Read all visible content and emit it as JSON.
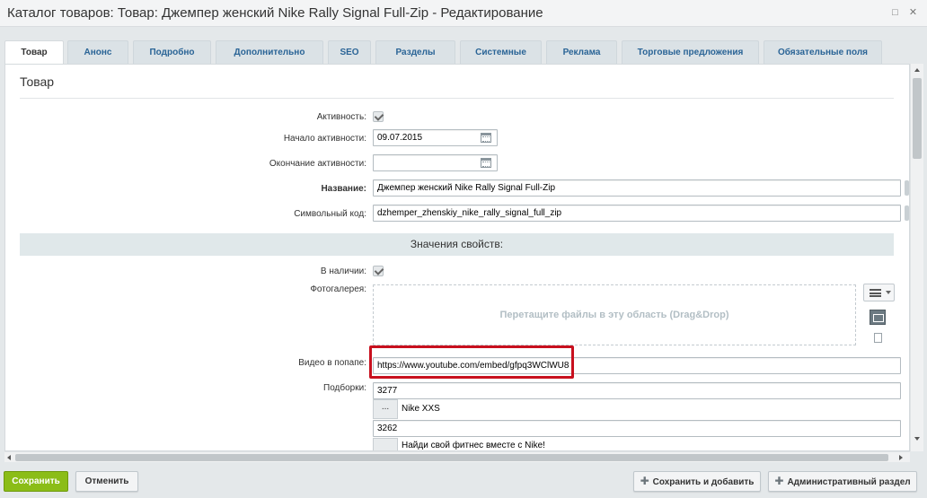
{
  "window": {
    "title": "Каталог товаров: Товар: Джемпер женский Nike Rally Signal Full-Zip - Редактирование",
    "restore_icon": "restore-icon",
    "close_icon": "close-icon"
  },
  "tabs": [
    {
      "label": "Товар",
      "active": true
    },
    {
      "label": "Анонс"
    },
    {
      "label": "Подробно"
    },
    {
      "label": "Дополнительно"
    },
    {
      "label": "SEO"
    },
    {
      "label": "Разделы"
    },
    {
      "label": "Системные"
    },
    {
      "label": "Реклама"
    },
    {
      "label": "Торговые предложения"
    },
    {
      "label": "Обязательные поля"
    }
  ],
  "section": {
    "title": "Товар"
  },
  "fields": {
    "active": {
      "label": "Активность:",
      "checked": true
    },
    "active_from": {
      "label": "Начало активности:",
      "value": "09.07.2015"
    },
    "active_to": {
      "label": "Окончание активности:",
      "value": ""
    },
    "name": {
      "label": "Название:",
      "value": "Джемпер женский Nike Rally Signal Full-Zip"
    },
    "code": {
      "label": "Символьный код:",
      "value": "dzhemper_zhenskiy_nike_rally_signal_full_zip"
    }
  },
  "props": {
    "header": "Значения свойств:",
    "in_stock": {
      "label": "В наличии:",
      "checked": true
    },
    "gallery": {
      "label": "Фотогалерея:",
      "dropzone": "Перетащите файлы в эту область (Drag&Drop)"
    },
    "video": {
      "label": "Видео в попапе:",
      "value": "https://www.youtube.com/embed/gfpq3WClWU8"
    },
    "collections": {
      "label": "Подборки:",
      "items": [
        {
          "id": "3277",
          "button": "...",
          "name": "Nike XXS"
        },
        {
          "id": "3262",
          "button": "",
          "name": "Найди свой фитнес вместе с Nike!"
        }
      ]
    }
  },
  "buttons": {
    "save": "Сохранить",
    "cancel": "Отменить",
    "save_add": "Сохранить и добавить",
    "admin": "Административный раздел"
  },
  "colors": {
    "accent_green": "#8bbd17",
    "tab_link": "#2a6496",
    "highlight": "#c8101e"
  }
}
